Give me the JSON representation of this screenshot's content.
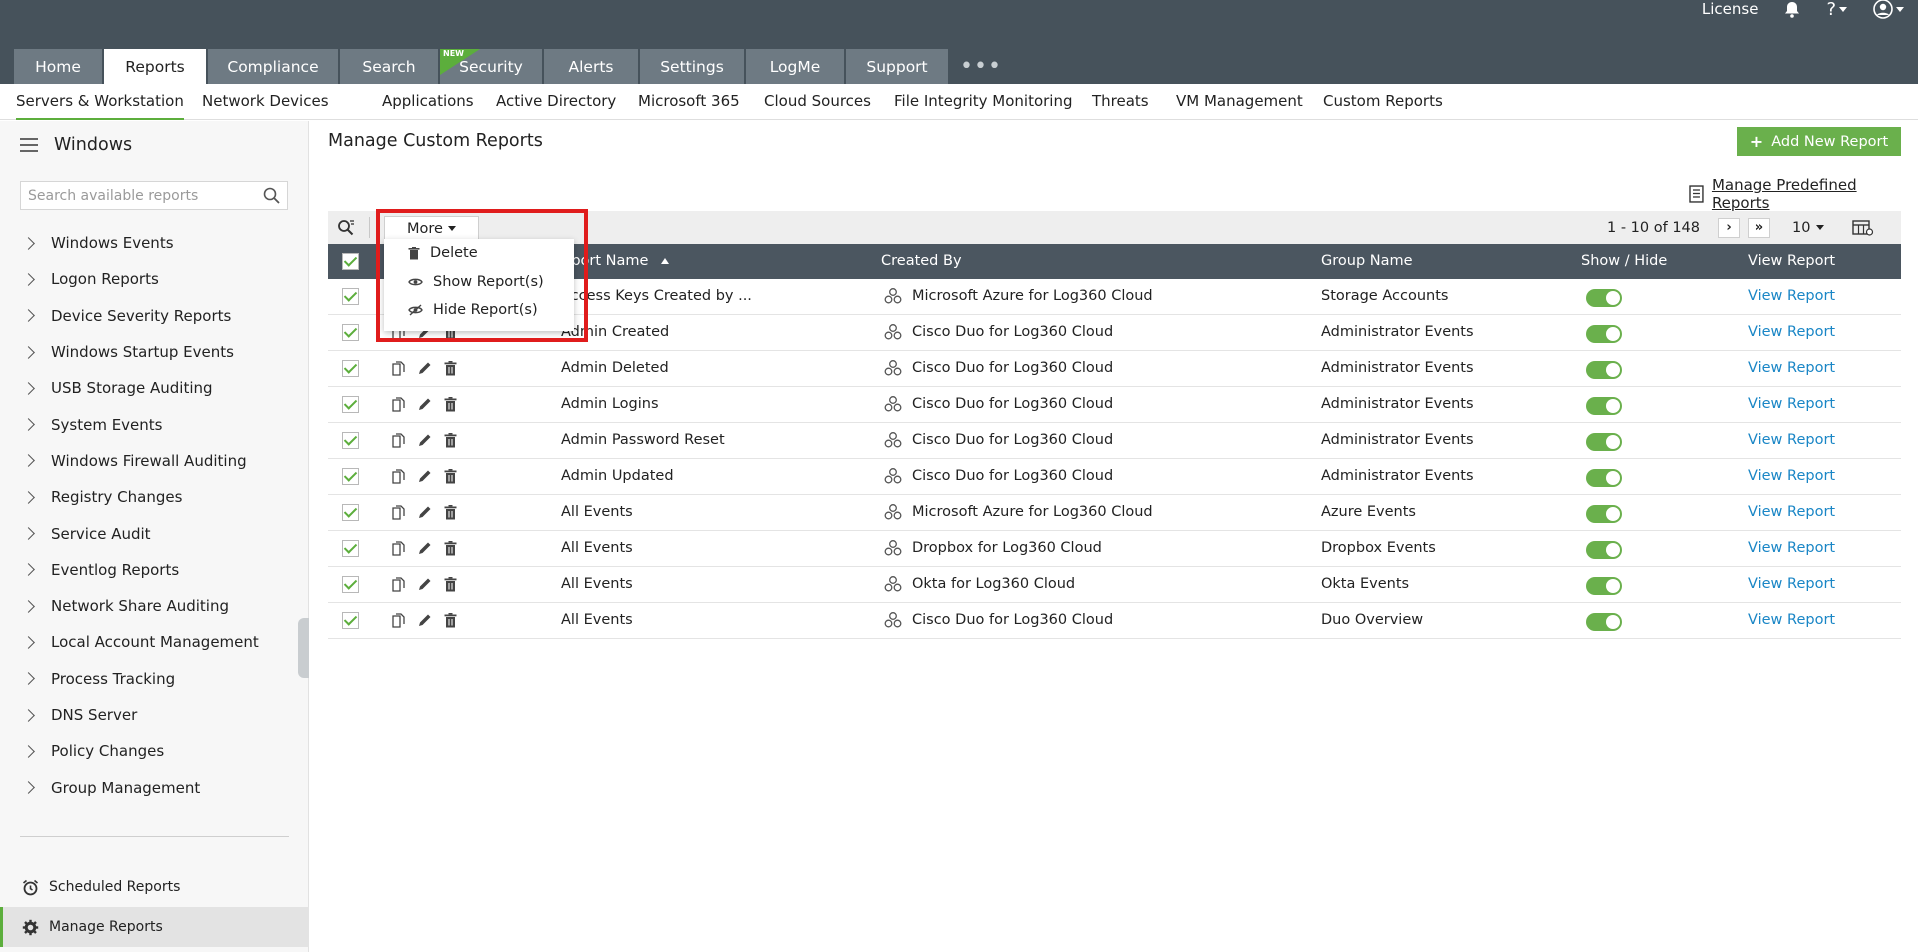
{
  "topbar": {
    "license_label": "License",
    "help_label": "?",
    "tabs": [
      {
        "label": "Home"
      },
      {
        "label": "Reports"
      },
      {
        "label": "Compliance"
      },
      {
        "label": "Search"
      },
      {
        "label": "Security",
        "badge": "NEW"
      },
      {
        "label": "Alerts"
      },
      {
        "label": "Settings"
      },
      {
        "label": "LogMe"
      },
      {
        "label": "Support"
      }
    ],
    "more_label": "•••"
  },
  "subnav": {
    "items": [
      "Servers & Workstation",
      "Network Devices",
      "Applications",
      "Active Directory",
      "Microsoft 365",
      "Cloud Sources",
      "File Integrity Monitoring",
      "Threats",
      "VM Management",
      "Custom Reports"
    ]
  },
  "sidebar": {
    "title": "Windows",
    "search_placeholder": "Search available reports",
    "items": [
      "Windows Events",
      "Logon Reports",
      "Device Severity Reports",
      "Windows Startup Events",
      "USB Storage Auditing",
      "System Events",
      "Windows Firewall Auditing",
      "Registry Changes",
      "Service Audit",
      "Eventlog Reports",
      "Network Share Auditing",
      "Local Account Management",
      "Process Tracking",
      "DNS Server",
      "Policy Changes",
      "Group Management"
    ],
    "scheduled_reports": "Scheduled Reports",
    "manage_reports": "Manage Reports"
  },
  "main": {
    "title": "Manage Custom Reports",
    "add_button": "Add New Report",
    "manage_predefined": "Manage Predefined Reports",
    "more_button": "More",
    "pagination": "1 - 10 of 148",
    "page_size": "10",
    "menu": {
      "delete": "Delete",
      "show": "Show Report(s)",
      "hide": "Hide Report(s)"
    },
    "columns": {
      "report_name": "Report Name",
      "created_by": "Created By",
      "group_name": "Group Name",
      "show_hide": "Show / Hide",
      "view_report": "View Report"
    },
    "rows": [
      {
        "name": "Access Keys Created by ...",
        "created_by": "Microsoft Azure for Log360 Cloud",
        "group": "Storage Accounts",
        "link": "View Report"
      },
      {
        "name": "Admin Created",
        "created_by": "Cisco Duo for Log360 Cloud",
        "group": "Administrator Events",
        "link": "View Report"
      },
      {
        "name": "Admin Deleted",
        "created_by": "Cisco Duo for Log360 Cloud",
        "group": "Administrator Events",
        "link": "View Report"
      },
      {
        "name": "Admin Logins",
        "created_by": "Cisco Duo for Log360 Cloud",
        "group": "Administrator Events",
        "link": "View Report"
      },
      {
        "name": "Admin Password Reset",
        "created_by": "Cisco Duo for Log360 Cloud",
        "group": "Administrator Events",
        "link": "View Report"
      },
      {
        "name": "Admin Updated",
        "created_by": "Cisco Duo for Log360 Cloud",
        "group": "Administrator Events",
        "link": "View Report"
      },
      {
        "name": "All Events",
        "created_by": "Microsoft Azure for Log360 Cloud",
        "group": "Azure Events",
        "link": "View Report"
      },
      {
        "name": "All Events",
        "created_by": "Dropbox for Log360 Cloud",
        "group": "Dropbox Events",
        "link": "View Report"
      },
      {
        "name": "All Events",
        "created_by": "Okta for Log360 Cloud",
        "group": "Okta Events",
        "link": "View Report"
      },
      {
        "name": "All Events",
        "created_by": "Cisco Duo for Log360 Cloud",
        "group": "Duo Overview",
        "link": "View Report"
      }
    ]
  },
  "colors": {
    "topbar": "#46525b",
    "tab_inactive": "#6e7a83",
    "accent_green": "#6ab04c",
    "link_blue": "#1a86c6",
    "highlight_red": "#e01c1c"
  }
}
